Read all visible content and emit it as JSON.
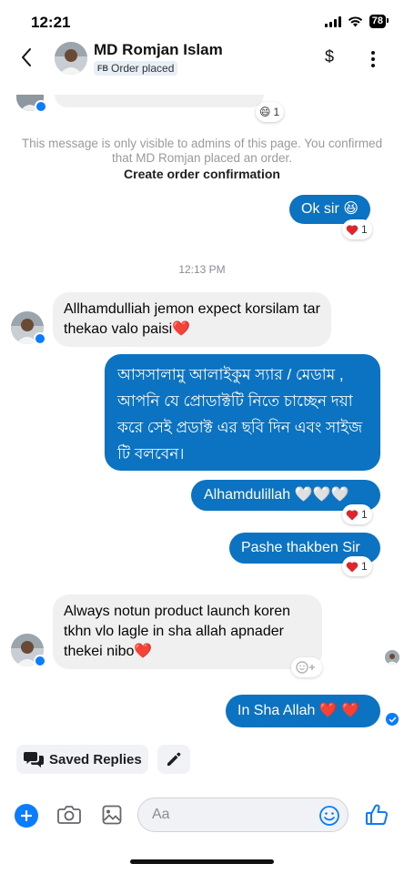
{
  "status_bar": {
    "time": "12:21",
    "battery": "78"
  },
  "header": {
    "contact_name": "MD Romjan Islam",
    "badge_prefix": "FB",
    "badge_label": "Order placed",
    "payment_symbol": "$"
  },
  "top_reaction": {
    "emoji": "😄",
    "count": "1"
  },
  "system_note": {
    "text": "This message is only visible to admins of this page. You confirmed that MD Romjan placed an order.",
    "action_label": "Create order confirmation"
  },
  "messages": {
    "out_ok": {
      "text": "Ok sir 😆",
      "reaction_count": "1"
    },
    "timestamp": "12:13 PM",
    "in_1": {
      "text": "Allhamdulliah jemon expect korsilam tar thekao valo paisi❤️"
    },
    "out_bangla": {
      "text": "আসসালামু আলাইকুম স্যার / মেডাম , আপনি যে প্রোডাক্টটি নিতে চাচ্ছেন দয়া করে সেই প্রডাক্ট এর ছবি দিন এবং সাইজ টি বলবেন।"
    },
    "out_alhamdulillah": {
      "text": "Alhamdulillah 🤍🤍🤍",
      "reaction_count": "1"
    },
    "out_pashe": {
      "text": "Pashe thakben Sir",
      "reaction_count": "1"
    },
    "in_2": {
      "text": "Always notun product launch koren tkhn vlo lagle in sha allah apnader thekei nibo❤️"
    },
    "out_inshaallah": {
      "text": "In Sha Allah ❤️ ❤️"
    }
  },
  "quick_actions": {
    "saved_replies_label": "Saved Replies"
  },
  "composer": {
    "placeholder": "Aa"
  },
  "colors": {
    "accent": "#0a7cff",
    "outgoing_bubble": "#0b73c2",
    "incoming_bubble": "#f0f0f0",
    "heart": "#e0242e"
  }
}
